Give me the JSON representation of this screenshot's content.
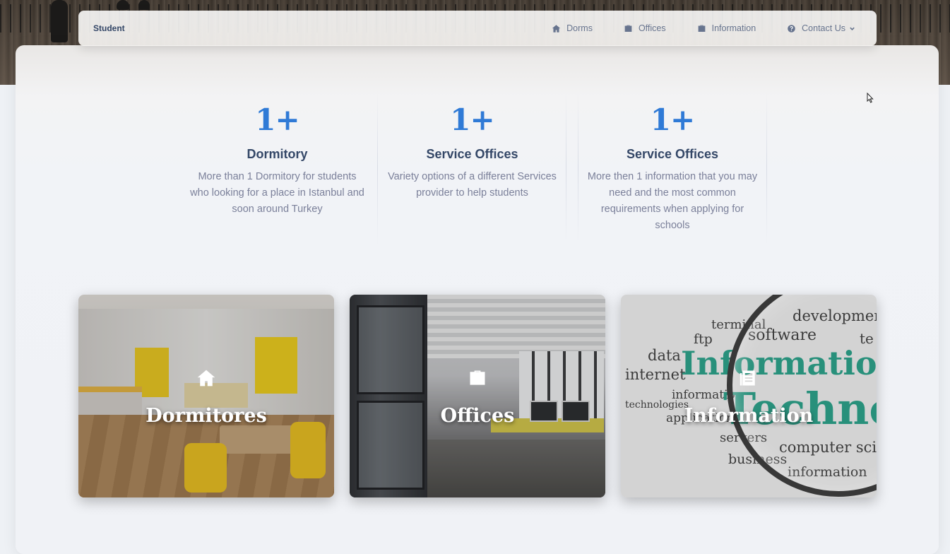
{
  "navbar": {
    "brand": "Student",
    "items": [
      {
        "label": "Dorms",
        "icon": "home-icon"
      },
      {
        "label": "Offices",
        "icon": "briefcase-icon"
      },
      {
        "label": "Information",
        "icon": "briefcase-icon"
      },
      {
        "label": "Contact Us",
        "icon": "help-icon",
        "has_dropdown": true
      }
    ]
  },
  "stats": [
    {
      "number": "1+",
      "title": "Dormitory",
      "description": "More than 1 Dormitory for students who looking for a place in Istanbul and soon around Turkey"
    },
    {
      "number": "1+",
      "title": "Service Offices",
      "description": "Variety options of a different Services provider to help students"
    },
    {
      "number": "1+",
      "title": "Service Offices",
      "description": "More then 1 information that you may need and the most common requirements when applying for schools"
    }
  ],
  "cards": [
    {
      "title": "Dormitores",
      "icon": "home-icon"
    },
    {
      "title": "Offices",
      "icon": "briefcase-icon"
    },
    {
      "title": "Information",
      "icon": "newspaper-icon"
    }
  ],
  "info_image_words": {
    "development": "development",
    "terminal": "terminal",
    "ftp": "ftp",
    "software": "software",
    "data": "data",
    "internet": "internet",
    "information": "information",
    "technologies": "technologies",
    "application": "application",
    "servers": "servers",
    "business": "business",
    "computer_science": "computer science",
    "information2": "information",
    "big1": "Informatio",
    "big2": "Techno",
    "te": "te"
  },
  "colors": {
    "accent": "#2f7ad6",
    "heading": "#344767",
    "muted": "#7b809a"
  }
}
